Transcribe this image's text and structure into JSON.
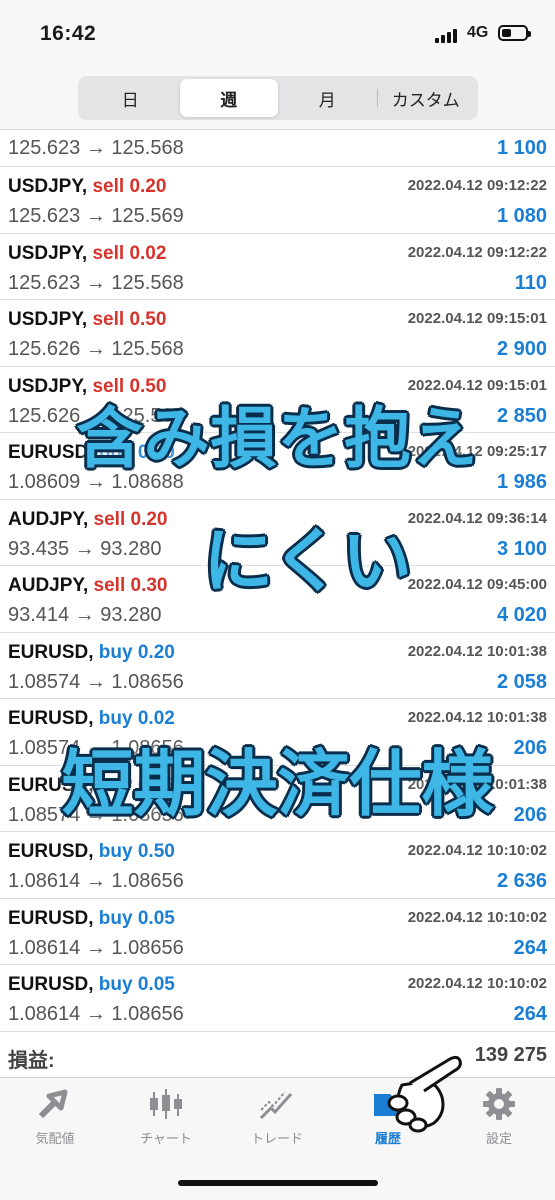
{
  "status": {
    "time": "16:42",
    "network": "4G"
  },
  "segments": [
    {
      "label": "日",
      "active": false
    },
    {
      "label": "週",
      "active": true
    },
    {
      "label": "月",
      "active": false
    },
    {
      "label": "カスタム",
      "active": false
    }
  ],
  "first_row": {
    "prices": "125.623 → 125.568",
    "profit": "1 100"
  },
  "rows": [
    {
      "symbol": "USDJPY,",
      "side": "sell 0.20",
      "type": "sell",
      "time": "2022.04.12 09:12:22",
      "prices": "125.623 → 125.569",
      "profit": "1 080"
    },
    {
      "symbol": "USDJPY,",
      "side": "sell 0.02",
      "type": "sell",
      "time": "2022.04.12 09:12:22",
      "prices": "125.623 → 125.568",
      "profit": "110"
    },
    {
      "symbol": "USDJPY,",
      "side": "sell 0.50",
      "type": "sell",
      "time": "2022.04.12 09:15:01",
      "prices": "125.626 → 125.568",
      "profit": "2 900"
    },
    {
      "symbol": "USDJPY,",
      "side": "sell 0.50",
      "type": "sell",
      "time": "2022.04.12 09:15:01",
      "prices": "125.626 → 125.568",
      "profit": "2 850"
    },
    {
      "symbol": "EURUSD,",
      "side": "buy 0.20",
      "type": "buy",
      "time": "2022.04.12 09:25:17",
      "prices": "1.08609 → 1.08688",
      "profit": "1 986"
    },
    {
      "symbol": "AUDJPY,",
      "side": "sell 0.20",
      "type": "sell",
      "time": "2022.04.12 09:36:14",
      "prices": "93.435 → 93.280",
      "profit": "3 100"
    },
    {
      "symbol": "AUDJPY,",
      "side": "sell 0.30",
      "type": "sell",
      "time": "2022.04.12 09:45:00",
      "prices": "93.414 → 93.280",
      "profit": "4 020"
    },
    {
      "symbol": "EURUSD,",
      "side": "buy 0.20",
      "type": "buy",
      "time": "2022.04.12 10:01:38",
      "prices": "1.08574 → 1.08656",
      "profit": "2 058"
    },
    {
      "symbol": "EURUSD,",
      "side": "buy 0.02",
      "type": "buy",
      "time": "2022.04.12 10:01:38",
      "prices": "1.08574 → 1.08656",
      "profit": "206"
    },
    {
      "symbol": "EURUSD,",
      "side": "buy 0.02",
      "type": "buy",
      "time": "2022.04.12 10:01:38",
      "prices": "1.08574 → 1.08656",
      "profit": "206"
    },
    {
      "symbol": "EURUSD,",
      "side": "buy 0.50",
      "type": "buy",
      "time": "2022.04.12 10:10:02",
      "prices": "1.08614 → 1.08656",
      "profit": "2 636"
    },
    {
      "symbol": "EURUSD,",
      "side": "buy 0.05",
      "type": "buy",
      "time": "2022.04.12 10:10:02",
      "prices": "1.08614 → 1.08656",
      "profit": "264"
    },
    {
      "symbol": "EURUSD,",
      "side": "buy 0.05",
      "type": "buy",
      "time": "2022.04.12 10:10:02",
      "prices": "1.08614 → 1.08656",
      "profit": "264"
    }
  ],
  "total": {
    "label": "損益:",
    "value": "139 275"
  },
  "tabs": [
    {
      "label": "気配値",
      "icon": "quotes-icon",
      "active": false
    },
    {
      "label": "チャート",
      "icon": "chart-icon",
      "active": false
    },
    {
      "label": "トレード",
      "icon": "trade-icon",
      "active": false
    },
    {
      "label": "履歴",
      "icon": "history-icon",
      "active": true
    },
    {
      "label": "設定",
      "icon": "gear-icon",
      "active": false
    }
  ],
  "overlay": {
    "line1": "含み損を抱え",
    "line2": "にくい",
    "line3": "短期決済仕様"
  },
  "colors": {
    "sell": "#d6332b",
    "buy": "#1a7fd4",
    "overlay_text": "#3fb7e6",
    "overlay_outline": "#0a2f4d"
  }
}
